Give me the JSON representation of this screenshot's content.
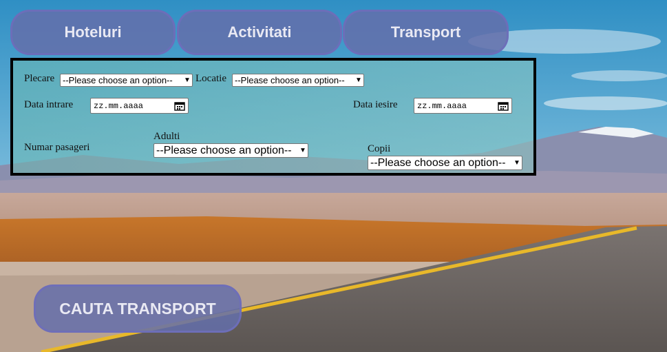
{
  "tabs": [
    {
      "label": "Hoteluri"
    },
    {
      "label": "Activitati"
    },
    {
      "label": "Transport"
    }
  ],
  "form": {
    "plecare": {
      "label": "Plecare",
      "value": "--Please choose an option--"
    },
    "locatie": {
      "label": "Locatie",
      "value": "--Please choose an option--"
    },
    "data_intrare": {
      "label": "Data intrare",
      "placeholder": "zz.mm.aaaa"
    },
    "data_iesire": {
      "label": "Data iesire",
      "placeholder": "zz.mm.aaaa"
    },
    "numar_pasageri": {
      "label": "Numar pasageri"
    },
    "adulti": {
      "label": "Adulti",
      "value": "--Please choose an option--"
    },
    "copii": {
      "label": "Copii",
      "value": "--Please choose an option--"
    }
  },
  "search_button": {
    "label": "CAUTA TRANSPORT"
  },
  "icons": {
    "select_arrow": "chevron-down-icon",
    "date_picker": "calendar-icon"
  },
  "colors": {
    "button_bg": "#646eaa",
    "button_text": "#e9e9f3",
    "form_border": "#000000"
  }
}
